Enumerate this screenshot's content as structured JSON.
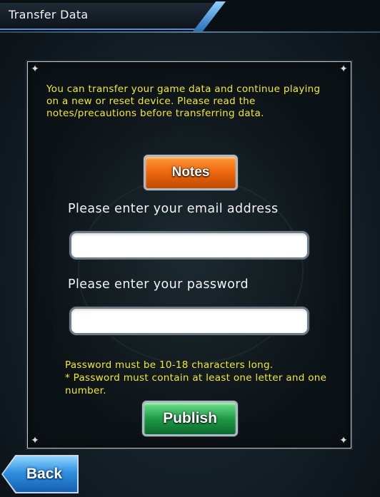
{
  "header": {
    "title": "Transfer Data"
  },
  "panel": {
    "intro": "You can transfer your game data and continue playing on a new or reset device. Please read the notes/precautions before transferring data.",
    "notes_label": "Notes",
    "email_label": "Please enter your email address",
    "email_value": "",
    "password_label": "Please enter your password",
    "password_value": "",
    "hint_line1": "Password must be 10-18 characters long.",
    "hint_line2": "* Password must contain at least one letter and one number.",
    "publish_label": "Publish"
  },
  "footer": {
    "back_label": "Back"
  },
  "colors": {
    "hint_text": "#f2e92f",
    "notes_button": "#f06a10",
    "publish_button": "#1f9a48",
    "back_button": "#2f8fe0"
  }
}
